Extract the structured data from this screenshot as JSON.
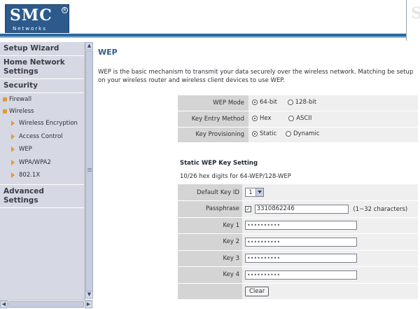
{
  "brand": {
    "logo_text": "SMC",
    "registered": "R",
    "sub_text": "Networks",
    "accent": "#2b5f8f"
  },
  "sidebar": {
    "setup_wizard": "Setup Wizard",
    "home_network": "Home Network Settings",
    "security": "Security",
    "items": [
      {
        "label": "Firewall"
      },
      {
        "label": "Wireless"
      }
    ],
    "wireless_items": [
      {
        "label": "Wireless Encryption"
      },
      {
        "label": "Access Control"
      },
      {
        "label": "WEP"
      },
      {
        "label": "WPA/WPA2"
      },
      {
        "label": "802.1X"
      }
    ],
    "advanced": "Advanced Settings"
  },
  "main": {
    "title": "WEP",
    "description": "WEP is the basic mechanism to transmit your data securely over the wireless network. Matching be setup on your wireless router and wireless client devices to use WEP.",
    "wep_mode": {
      "label": "WEP Mode",
      "options": [
        "64-bit",
        "128-bit"
      ],
      "selected": "64-bit"
    },
    "key_entry": {
      "label": "Key Entry Method",
      "options": [
        "Hex",
        "ASCII"
      ],
      "selected": "Hex"
    },
    "key_provisioning": {
      "label": "Key Provisioning",
      "options": [
        "Static",
        "Dynamic"
      ],
      "selected": "Static"
    },
    "static_title": "Static WEP Key Setting",
    "hex_note": "10/26 hex digits for 64-WEP/128-WEP",
    "default_key": {
      "label": "Default Key ID",
      "value": "1"
    },
    "passphrase": {
      "label": "Passphrase",
      "checked": true,
      "value": "3310862246",
      "hint": "(1~32 characters)"
    },
    "keys": [
      {
        "label": "Key 1",
        "value": "••••••••••"
      },
      {
        "label": "Key 2",
        "value": "••••••••••"
      },
      {
        "label": "Key 3",
        "value": "••••••••••"
      },
      {
        "label": "Key 4",
        "value": "••••••••••"
      }
    ],
    "clear_label": "Clear"
  },
  "scroll": {
    "up": "▲",
    "down": "▼",
    "left": "◀",
    "right": "▶"
  }
}
